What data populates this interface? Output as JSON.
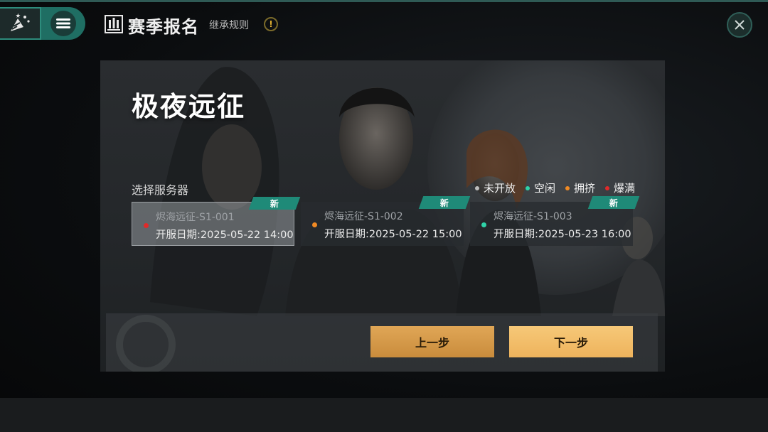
{
  "header": {
    "title": "赛季报名",
    "rules_link": "继承规则",
    "warning_glyph": "!"
  },
  "icons": {
    "party": "party-popper-icon",
    "menu": "hamburger-menu-icon",
    "title": "trophy-frame-icon",
    "warning": "warning-icon",
    "close": "close-icon"
  },
  "season": {
    "name": "极夜远征",
    "select_server_label": "选择服务器"
  },
  "legend": [
    {
      "label": "未开放",
      "color": "#bdbdbd"
    },
    {
      "label": "空闲",
      "color": "#2fd3a8"
    },
    {
      "label": "拥挤",
      "color": "#f08a24"
    },
    {
      "label": "爆满",
      "color": "#e02a2a"
    }
  ],
  "servers": [
    {
      "name": "烬海远征-S1-001",
      "date_label": "开服日期:",
      "date": "2025-05-22 14:00",
      "status_color": "#e02a2a",
      "badge": "新",
      "selected": true
    },
    {
      "name": "烬海远征-S1-002",
      "date_label": "开服日期:",
      "date": "2025-05-22 15:00",
      "status_color": "#f08a24",
      "badge": "新",
      "selected": false
    },
    {
      "name": "烬海远征-S1-003",
      "date_label": "开服日期:",
      "date": "2025-05-23 16:00",
      "status_color": "#2fd3a8",
      "badge": "新",
      "selected": false
    }
  ],
  "actions": {
    "prev": "上一步",
    "next": "下一步"
  },
  "colors": {
    "accent_teal": "#1f8a78",
    "button_gold": "#eeb35c"
  }
}
